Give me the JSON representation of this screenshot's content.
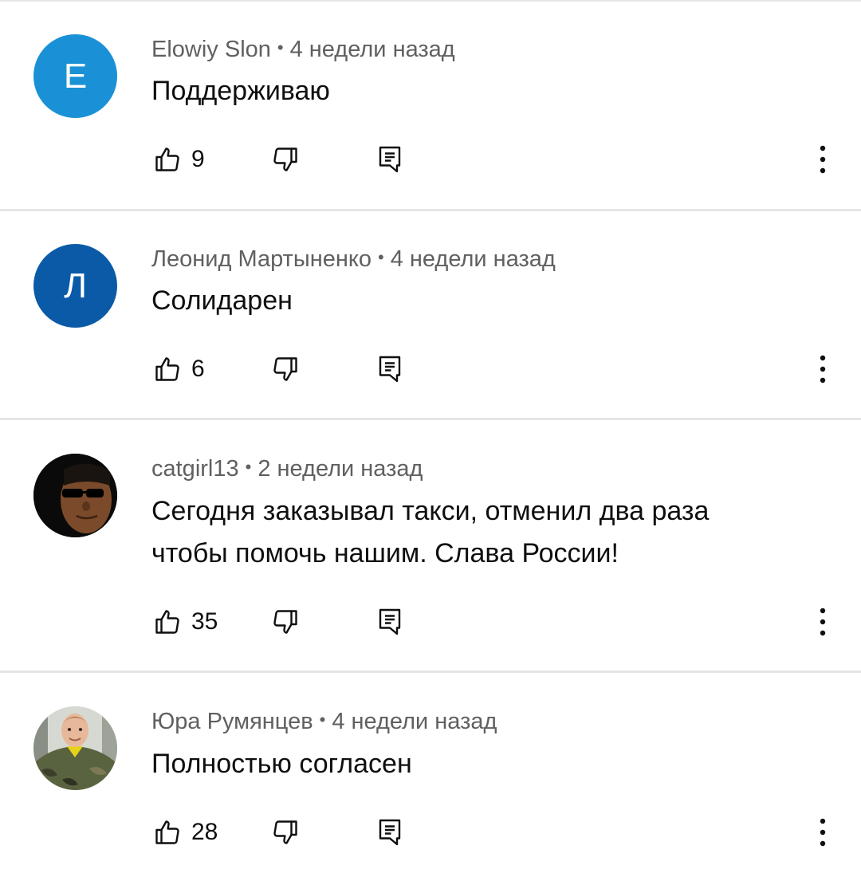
{
  "comments": [
    {
      "author": "Elowiy Slon",
      "separator": "•",
      "time": "4 недели назад",
      "text": "Поддерживаю",
      "likes": "9",
      "avatar": {
        "type": "letter",
        "letter": "E",
        "color": "#1a91d6"
      }
    },
    {
      "author": "Леонид Мартыненко",
      "separator": "•",
      "time": "4 недели назад",
      "text": "Солидарен",
      "likes": "6",
      "avatar": {
        "type": "letter",
        "letter": "Л",
        "color": "#0b5aa8"
      }
    },
    {
      "author": "catgirl13",
      "separator": "•",
      "time": "2 недели назад",
      "text": "Сегодня заказывал такси, отменил два раза чтобы помочь нашим. Слава России!",
      "likes": "35",
      "avatar": {
        "type": "photo",
        "description_icon": "man-with-sunglasses-avatar"
      }
    },
    {
      "author": "Юра Румянцев",
      "separator": "•",
      "time": "4 недели назад",
      "text": "Полностью согласен",
      "likes": "28",
      "avatar": {
        "type": "photo",
        "description_icon": "young-man-camo-avatar"
      }
    }
  ],
  "icons": {
    "like": "thumbs-up-icon",
    "dislike": "thumbs-down-icon",
    "reply": "reply-comment-icon",
    "more": "more-vertical-icon"
  },
  "colors": {
    "divider": "#e5e5e5",
    "meta_text": "#606060",
    "body_text": "#0f0f0f"
  }
}
